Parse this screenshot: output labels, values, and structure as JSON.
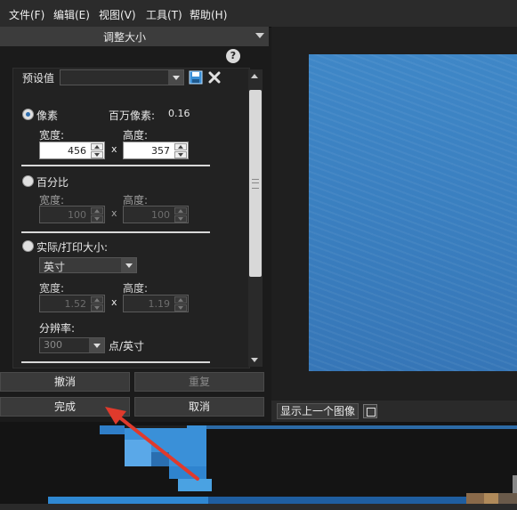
{
  "menu": [
    "文件(F)",
    "编辑(E)",
    "视图(V)",
    "工具(T)",
    "帮助(H)"
  ],
  "panel": {
    "title": "调整大小",
    "help": "?",
    "preset_label": "预设值",
    "preset_value": "",
    "pixels": {
      "label": "像素",
      "megapixels_label": "百万像素:",
      "megapixels_value": "0.16",
      "width_label": "宽度:",
      "height_label": "高度:",
      "width": "456",
      "height": "357",
      "x": "x"
    },
    "percent": {
      "label": "百分比",
      "width_label": "宽度:",
      "height_label": "高度:",
      "width": "100",
      "height": "100",
      "x": "x"
    },
    "print": {
      "label": "实际/打印大小:",
      "unit": "英寸",
      "width_label": "宽度:",
      "height_label": "高度:",
      "width": "1.52",
      "height": "1.19",
      "x": "x",
      "resolution_label": "分辨率:",
      "resolution": "300",
      "resolution_unit": "点/英寸"
    },
    "buttons": {
      "cancel": "撤消",
      "redo": "重复",
      "done": "完成",
      "abort": "取消"
    }
  },
  "preview": {
    "prev_image_button": "显示上一个图像"
  },
  "colors": {
    "accent_blue": "#3a7fc0",
    "arrow_red": "#e03a2c"
  }
}
